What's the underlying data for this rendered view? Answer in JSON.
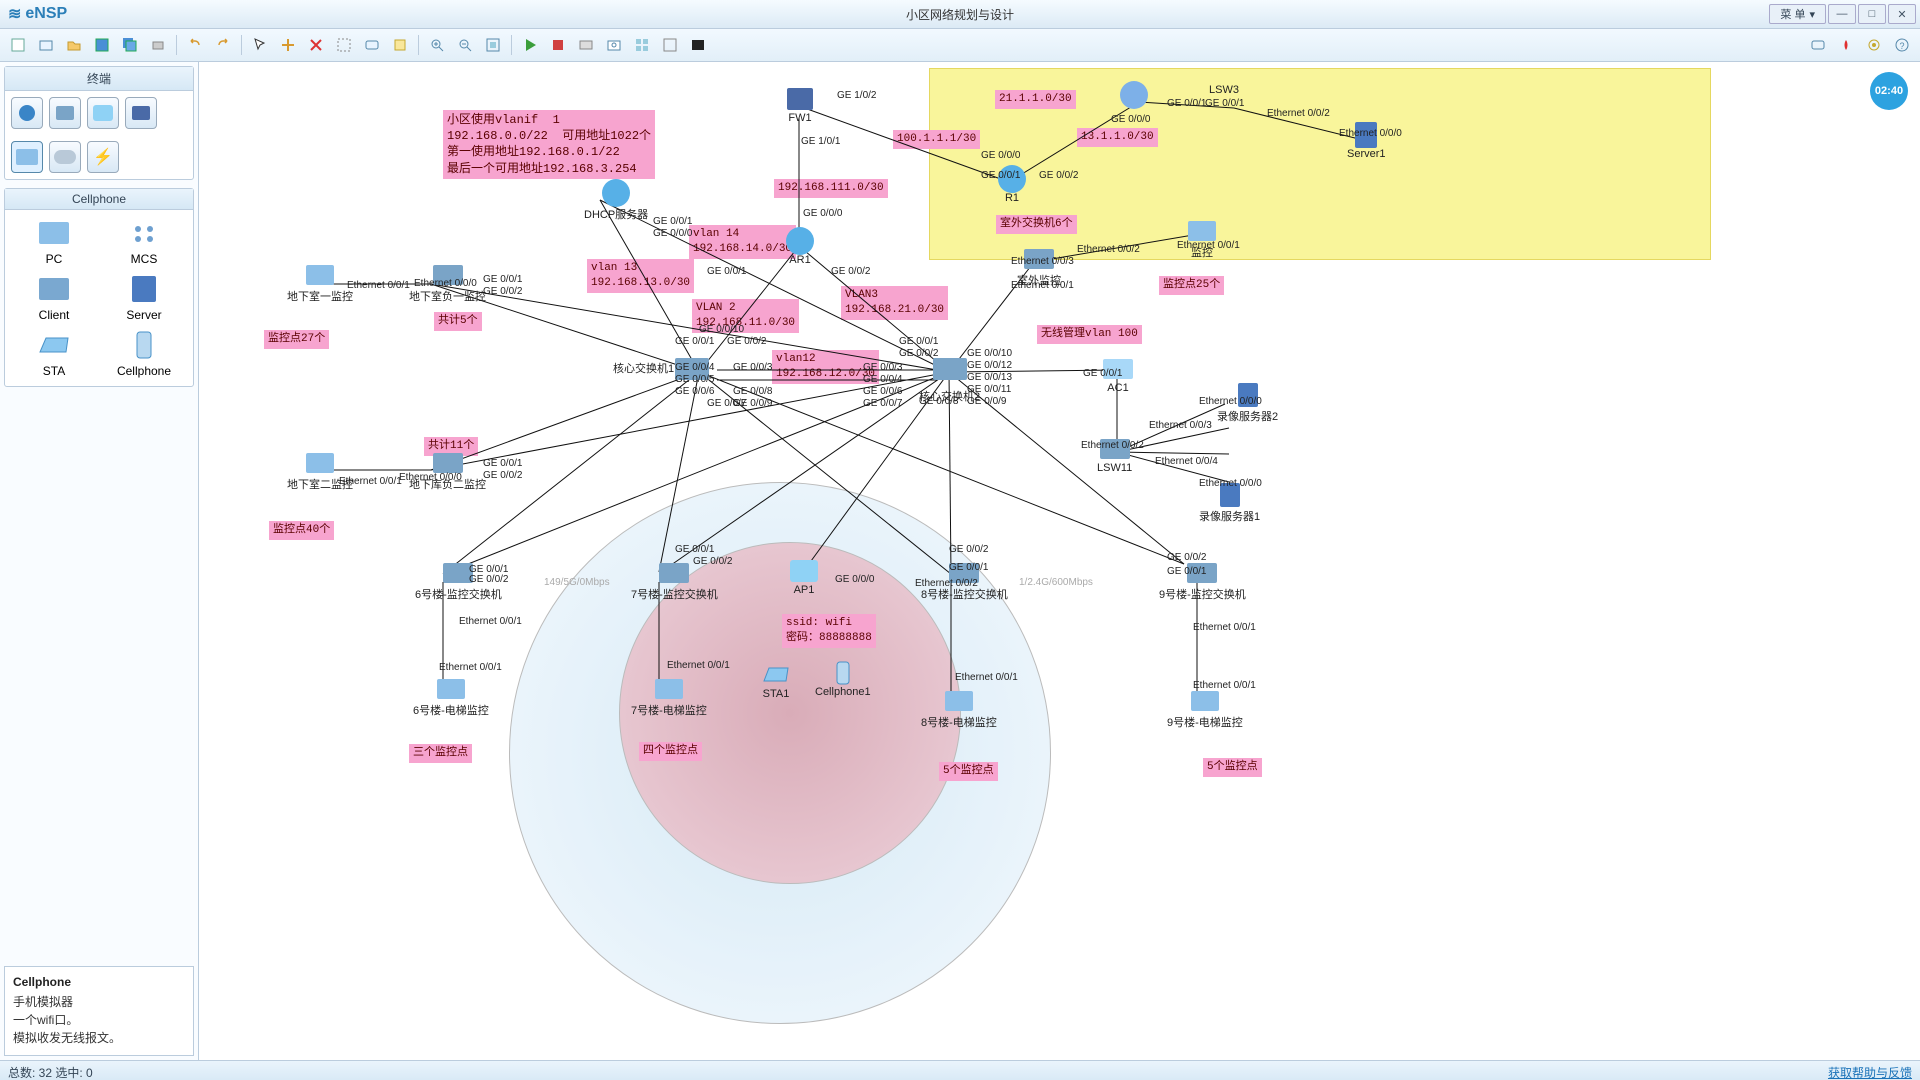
{
  "app": {
    "name": "eNSP",
    "title": "小区网络规划与设计",
    "menu_label": "菜 单"
  },
  "winbtns": {
    "min": "—",
    "max": "□",
    "close": "✕",
    "menu_arrow": "▾"
  },
  "sidebar": {
    "panel1": "终端",
    "panel2": "Cellphone",
    "devices": [
      {
        "id": "pc",
        "label": "PC"
      },
      {
        "id": "mcs",
        "label": "MCS"
      },
      {
        "id": "client",
        "label": "Client"
      },
      {
        "id": "server",
        "label": "Server"
      },
      {
        "id": "sta",
        "label": "STA"
      },
      {
        "id": "cellphone",
        "label": "Cellphone"
      }
    ],
    "desc": {
      "title": "Cellphone",
      "line1": "手机模拟器",
      "line2": "一个wifi口。",
      "line3": "模拟收发无线报文。"
    }
  },
  "statusbar": {
    "left_count": "总数: 32 选中: 0",
    "help": "获取帮助与反馈"
  },
  "time_badge": "02:40",
  "notes": {
    "vlanif": "小区使用vlanif  1\n192.168.0.0/22  可用地址1022个\n第一使用地址192.168.0.1/22\n最后一个可用地址192.168.3.254",
    "count5": "共计5个",
    "p27": "监控点27个",
    "p40": "监控点40个",
    "count11": "共计11个",
    "v13": "vlan 13\n192.168.13.0/30",
    "v14": "vlan 14\n192.168.14.0/30",
    "v2": "VLAN 2\n192.168.11.0/30",
    "v12": "vlan12\n192.168.12.0/30",
    "v3": "VLAN3\n192.168.21.0/30",
    "n111": "192.168.111.0/30",
    "n100": "100.1.1.1/30",
    "n21": "21.1.1.0/30",
    "n13": "13.1.1.0/30",
    "outswitch": "室外交换机6个",
    "p25": "监控点25个",
    "wlan100": "无线管理vlan 100",
    "ssid": "ssid: wifi\n密码：88888888",
    "b6": "三个监控点",
    "b7": "四个监控点",
    "b8": "5个监控点",
    "b9": "5个监控点"
  },
  "wifi_labels": {
    "left": "149/5G/0Mbps",
    "right": "1/2.4G/600Mbps"
  },
  "devices": {
    "dhcp": "DHCP服务器",
    "ar1": "AR1",
    "fw1": "FW1",
    "r1": "R1",
    "lsw3": "LSW3",
    "server1": "Server1",
    "core1": "核心交换机1",
    "core2": "核心交换机2",
    "ac1": "AC1",
    "lsw11": "LSW11",
    "rec2": "录像服务器2",
    "rec1": "录像服务器1",
    "mon_out": "室外监控",
    "mon_out2": "监控",
    "b1mon": "地下室一监控",
    "b1sw": "地下室负一监控",
    "b2mon": "地下室二监控",
    "b2sw": "地下库负二监控",
    "sw6": "6号楼-监控交换机",
    "sw7": "7号楼-监控交换机",
    "sw8": "8号楼-监控交换机",
    "sw9": "9号楼-监控交换机",
    "el6": "6号楼-电梯监控",
    "el7": "7号楼-电梯监控",
    "el8": "8号楼-电梯监控",
    "el9": "9号楼-电梯监控",
    "ap1": "AP1",
    "sta1": "STA1",
    "cell1": "Cellphone1"
  },
  "ports": {
    "ge000": "GE 0/0/0",
    "ge001": "GE 0/0/1",
    "ge002": "GE 0/0/2",
    "ge003": "GE 0/0/3",
    "ge004": "GE 0/0/4",
    "ge005": "GE 0/0/5",
    "ge006": "GE 0/0/6",
    "ge007": "GE 0/0/7",
    "ge008": "GE 0/0/8",
    "ge009": "GE 0/0/9",
    "ge0010": "GE 0/0/10",
    "ge0011": "GE 0/0/11",
    "ge0012": "GE 0/0/12",
    "ge0013": "GE 0/0/13",
    "ge102": "GE 1/0/2",
    "ge101": "GE 1/0/1",
    "eth001": "Ethernet 0/0/1",
    "eth002": "Ethernet 0/0/2",
    "eth003": "Ethernet 0/0/3",
    "eth004": "Ethernet 0/0/4",
    "eth000": "Ethernet 0/0/0"
  },
  "toolbar_icons": [
    "new-topo-icon",
    "new-device-icon",
    "open-icon",
    "save-icon",
    "saveall-icon",
    "print-icon",
    "undo-icon",
    "redo-icon",
    "",
    "select-icon",
    "pan-icon",
    "delete-icon",
    "edit-icon",
    "text-icon",
    "shape-icon",
    "",
    "zoomin-icon",
    "zoomout-icon",
    "fit-icon",
    "",
    "play-icon",
    "stop-icon",
    "record-icon",
    "snapshot-icon",
    "grid-icon",
    "window-icon",
    "blackbox-icon"
  ],
  "toolbar_right_icons": [
    "message-icon",
    "huawei-icon",
    "settings-icon",
    "help-icon"
  ]
}
